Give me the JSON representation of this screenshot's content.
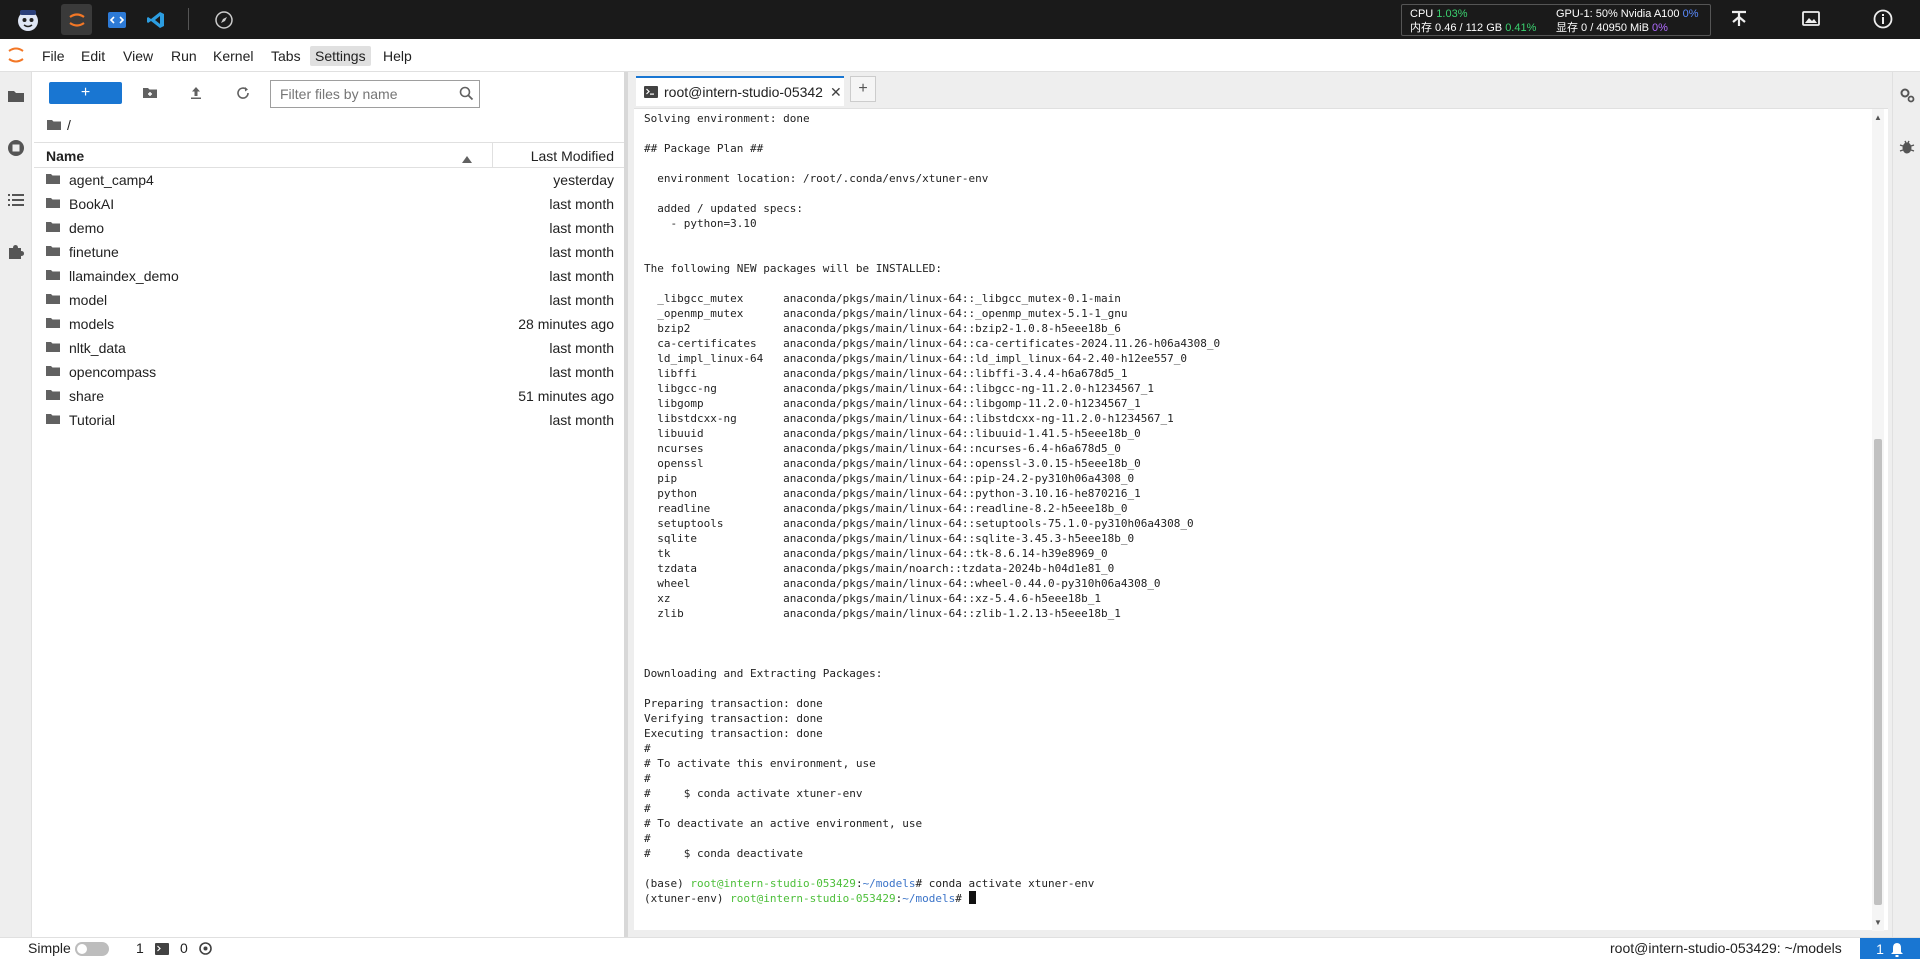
{
  "topbar": {
    "apps": [
      {
        "name": "intern-logo-icon"
      },
      {
        "name": "jupyter-app-icon"
      },
      {
        "name": "code-app-icon"
      },
      {
        "name": "vscode-app-icon"
      },
      {
        "name": "compass-app-icon"
      }
    ],
    "resources": {
      "cpu_label": "CPU",
      "cpu_value": "1.03%",
      "gpu_label": "GPU-1: 50% Nvidia A100",
      "gpu_value": "0%",
      "mem_label": "内存 0.46 / 112 GB",
      "mem_value": "0.41%",
      "vram_label": "显存 0 / 40950 MiB",
      "vram_value": "0%"
    }
  },
  "menu": {
    "items": [
      "File",
      "Edit",
      "View",
      "Run",
      "Kernel",
      "Tabs",
      "Settings",
      "Help"
    ]
  },
  "filebrowser": {
    "new_label": "+",
    "filter_placeholder": "Filter files by name",
    "breadcrumb": "/",
    "col_name": "Name",
    "col_modified": "Last Modified",
    "files": [
      {
        "name": "agent_camp4",
        "modified": "yesterday"
      },
      {
        "name": "BookAI",
        "modified": "last month"
      },
      {
        "name": "demo",
        "modified": "last month"
      },
      {
        "name": "finetune",
        "modified": "last month"
      },
      {
        "name": "llamaindex_demo",
        "modified": "last month"
      },
      {
        "name": "model",
        "modified": "last month"
      },
      {
        "name": "models",
        "modified": "28 minutes ago"
      },
      {
        "name": "nltk_data",
        "modified": "last month"
      },
      {
        "name": "opencompass",
        "modified": "last month"
      },
      {
        "name": "share",
        "modified": "51 minutes ago"
      },
      {
        "name": "Tutorial",
        "modified": "last month"
      }
    ]
  },
  "terminal": {
    "tab_label": "root@intern-studio-05342",
    "close": "✕",
    "add": "+",
    "lines": [
      "Solving environment: done",
      "",
      "## Package Plan ##",
      "",
      "  environment location: /root/.conda/envs/xtuner-env",
      "",
      "  added / updated specs:",
      "    - python=3.10",
      "",
      "",
      "The following NEW packages will be INSTALLED:",
      "",
      "  _libgcc_mutex      anaconda/pkgs/main/linux-64::_libgcc_mutex-0.1-main",
      "  _openmp_mutex      anaconda/pkgs/main/linux-64::_openmp_mutex-5.1-1_gnu",
      "  bzip2              anaconda/pkgs/main/linux-64::bzip2-1.0.8-h5eee18b_6",
      "  ca-certificates    anaconda/pkgs/main/linux-64::ca-certificates-2024.11.26-h06a4308_0",
      "  ld_impl_linux-64   anaconda/pkgs/main/linux-64::ld_impl_linux-64-2.40-h12ee557_0",
      "  libffi             anaconda/pkgs/main/linux-64::libffi-3.4.4-h6a678d5_1",
      "  libgcc-ng          anaconda/pkgs/main/linux-64::libgcc-ng-11.2.0-h1234567_1",
      "  libgomp            anaconda/pkgs/main/linux-64::libgomp-11.2.0-h1234567_1",
      "  libstdcxx-ng       anaconda/pkgs/main/linux-64::libstdcxx-ng-11.2.0-h1234567_1",
      "  libuuid            anaconda/pkgs/main/linux-64::libuuid-1.41.5-h5eee18b_0",
      "  ncurses            anaconda/pkgs/main/linux-64::ncurses-6.4-h6a678d5_0",
      "  openssl            anaconda/pkgs/main/linux-64::openssl-3.0.15-h5eee18b_0",
      "  pip                anaconda/pkgs/main/linux-64::pip-24.2-py310h06a4308_0",
      "  python             anaconda/pkgs/main/linux-64::python-3.10.16-he870216_1",
      "  readline           anaconda/pkgs/main/linux-64::readline-8.2-h5eee18b_0",
      "  setuptools         anaconda/pkgs/main/linux-64::setuptools-75.1.0-py310h06a4308_0",
      "  sqlite             anaconda/pkgs/main/linux-64::sqlite-3.45.3-h5eee18b_0",
      "  tk                 anaconda/pkgs/main/linux-64::tk-8.6.14-h39e8969_0",
      "  tzdata             anaconda/pkgs/main/noarch::tzdata-2024b-h04d1e81_0",
      "  wheel              anaconda/pkgs/main/linux-64::wheel-0.44.0-py310h06a4308_0",
      "  xz                 anaconda/pkgs/main/linux-64::xz-5.4.6-h5eee18b_1",
      "  zlib               anaconda/pkgs/main/linux-64::zlib-1.2.13-h5eee18b_1",
      "",
      "",
      "",
      "Downloading and Extracting Packages:",
      "",
      "Preparing transaction: done",
      "Verifying transaction: done",
      "Executing transaction: done",
      "#",
      "# To activate this environment, use",
      "#",
      "#     $ conda activate xtuner-env",
      "#",
      "# To deactivate an active environment, use",
      "#",
      "#     $ conda deactivate",
      ""
    ],
    "prompt1": {
      "env": "(base) ",
      "user": "root@intern-studio-053429",
      "colon": ":",
      "path": "~/models",
      "cmd": "# conda activate xtuner-env"
    },
    "prompt2": {
      "env": "(xtuner-env) ",
      "user": "root@intern-studio-053429",
      "colon": ":",
      "path": "~/models",
      "cmd": "# "
    }
  },
  "status": {
    "mode": "Simple",
    "kernels": "1",
    "terminals": "0",
    "host": "root@intern-studio-053429: ~/models",
    "notifications": "1"
  }
}
